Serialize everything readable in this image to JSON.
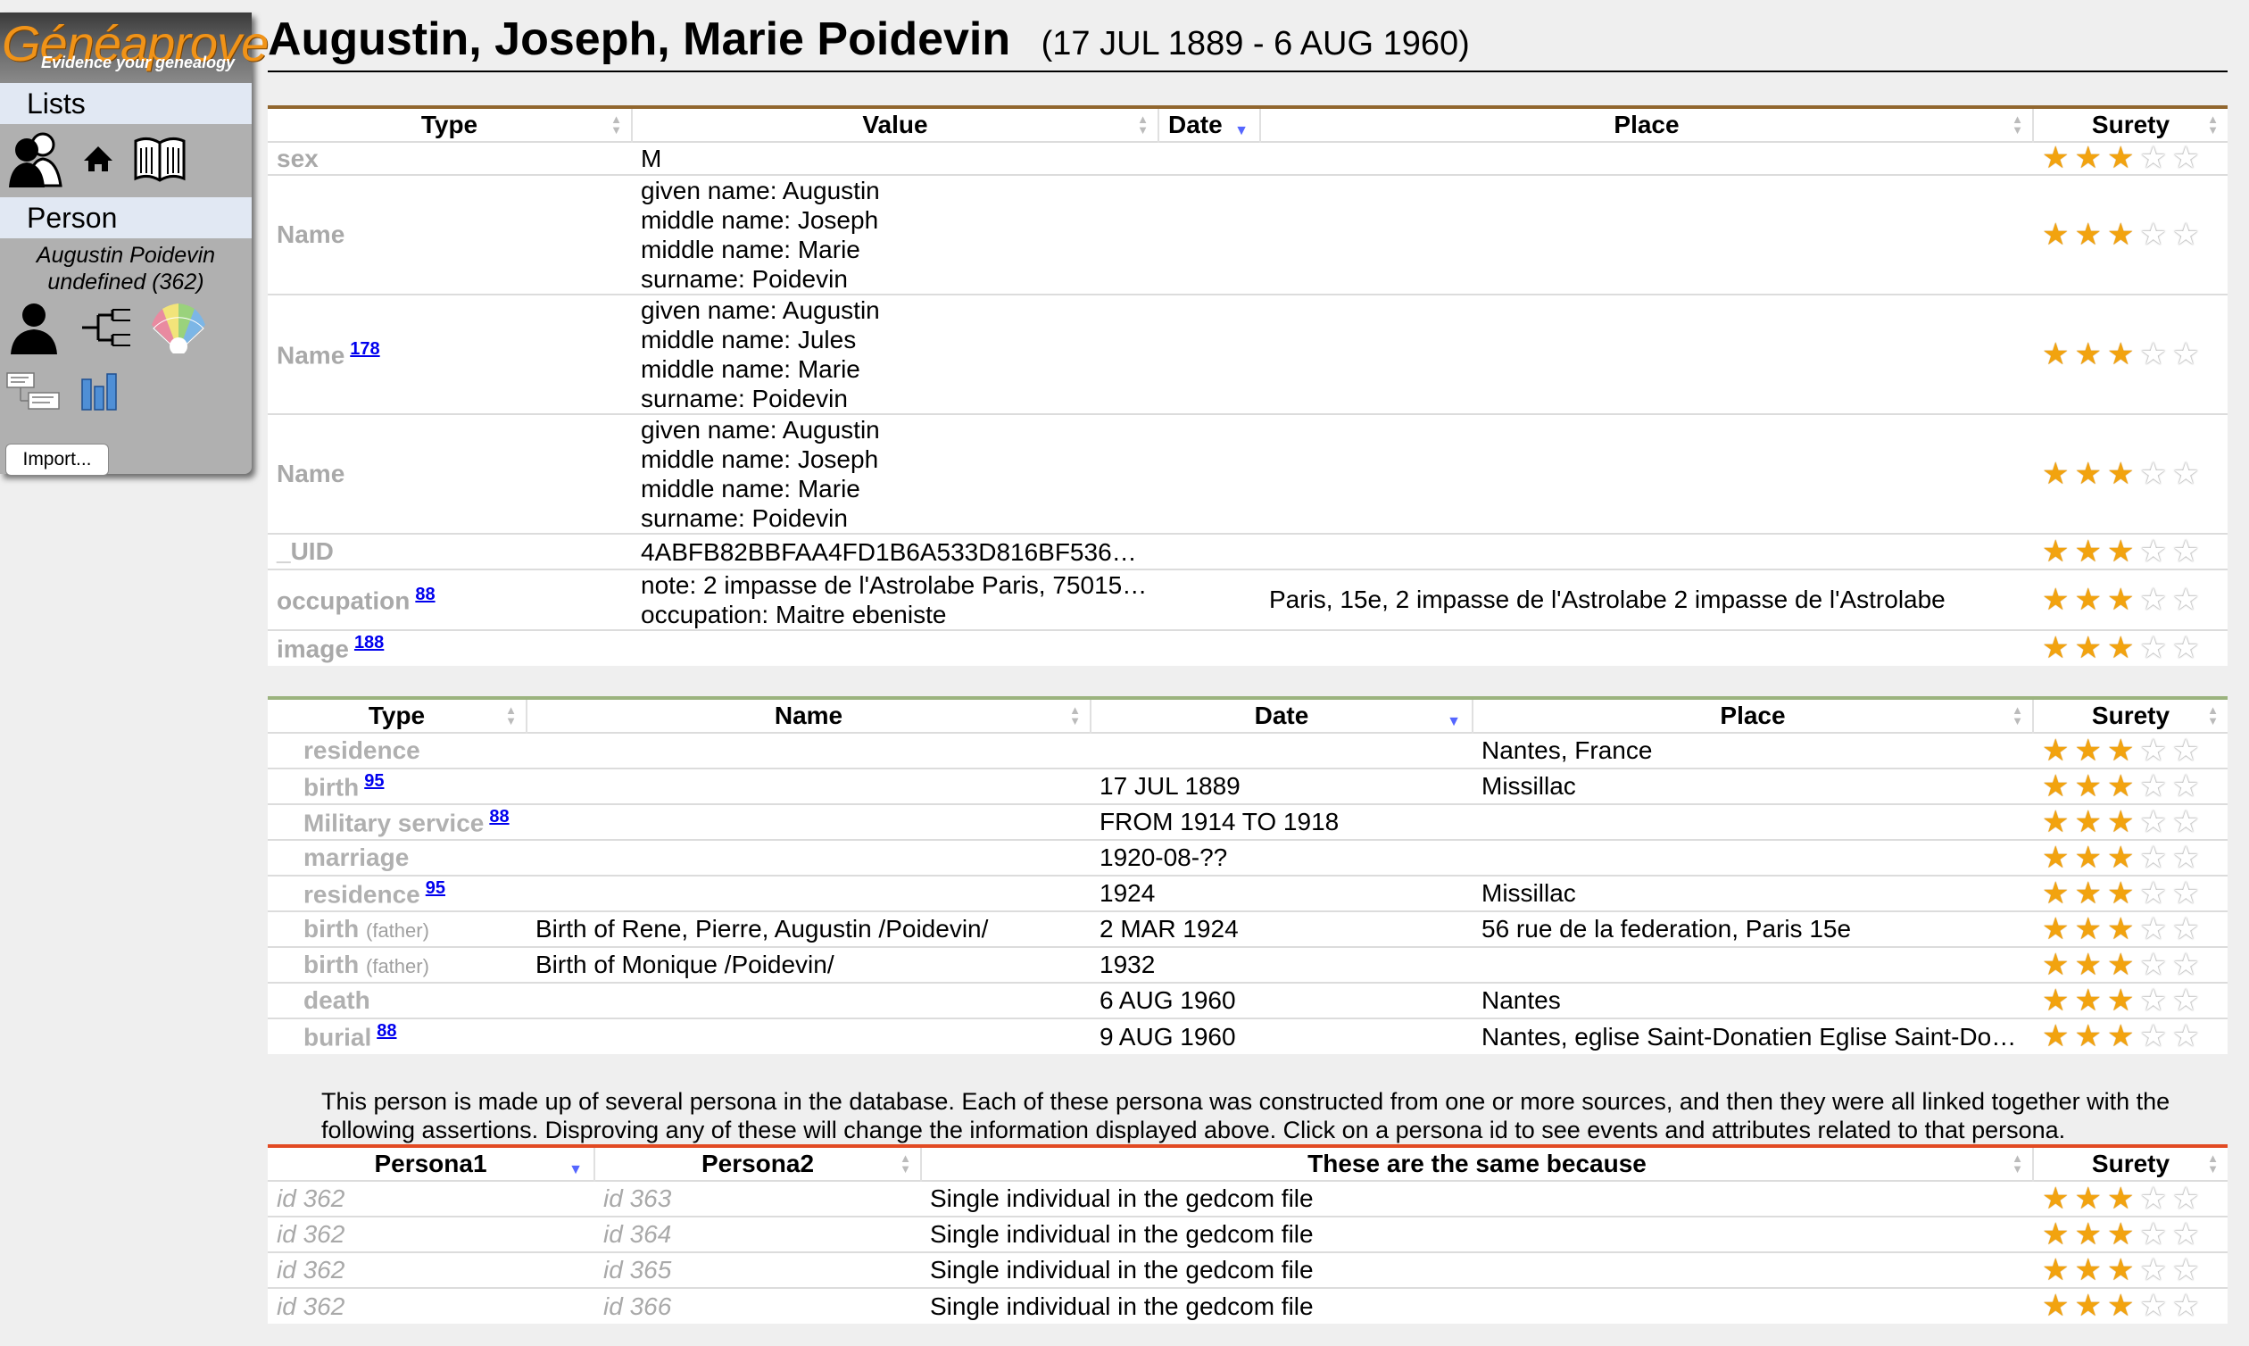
{
  "app": {
    "brand": "Généaprove",
    "tagline": "Evidence your genealogy",
    "lists_label": "Lists",
    "person_label": "Person",
    "person_name": "Augustin Poidevin",
    "person_sub": "undefined (362)",
    "import_label": "Import..."
  },
  "header": {
    "name": "Augustin, Joseph, Marie Poidevin",
    "dates": "(17 JUL 1889 - 6 AUG 1960)"
  },
  "colors": {
    "attributes_rule": "#91662e",
    "events_rule": "#9bb37e",
    "assertions_rule": "#e24a23",
    "star_on": "#f2a30f",
    "link": "#0000ee"
  },
  "attributes": {
    "columns": [
      "Type",
      "Value",
      "Date",
      "Place",
      "Surety"
    ],
    "rows": [
      {
        "type": "sex",
        "ref": "",
        "value": [
          "M"
        ],
        "date": "",
        "place": "",
        "surety": 3
      },
      {
        "type": "Name",
        "ref": "",
        "value": [
          "given name: Augustin",
          "middle name: Joseph",
          "middle name: Marie",
          "surname: Poidevin"
        ],
        "date": "",
        "place": "",
        "surety": 3
      },
      {
        "type": "Name",
        "ref": "178",
        "value": [
          "given name: Augustin",
          "middle name: Jules",
          "middle name: Marie",
          "surname: Poidevin"
        ],
        "date": "",
        "place": "",
        "surety": 3
      },
      {
        "type": "Name",
        "ref": "",
        "value": [
          "given name: Augustin",
          "middle name: Joseph",
          "middle name: Marie",
          "surname: Poidevin"
        ],
        "date": "",
        "place": "",
        "surety": 3
      },
      {
        "type": "_UID",
        "ref": "",
        "value": [
          "4ABFB82BBFAA4FD1B6A533D816BF536…"
        ],
        "date": "",
        "place": "",
        "surety": 3
      },
      {
        "type": "occupation",
        "ref": "88",
        "value": [
          "note: 2 impasse de l'Astrolabe Paris, 75015…",
          "occupation: Maitre ebeniste"
        ],
        "date": "",
        "place": "Paris, 15e, 2 impasse de l'Astrolabe 2 impasse de l'Astrolabe",
        "surety": 3
      },
      {
        "type": "image",
        "ref": "188",
        "value": [],
        "date": "",
        "place": "",
        "surety": 3
      }
    ]
  },
  "events": {
    "columns": [
      "Type",
      "Name",
      "Date",
      "Place",
      "Surety"
    ],
    "rows": [
      {
        "type": "residence",
        "ref": "",
        "role": "",
        "name": "",
        "date": "",
        "place": "Nantes, France",
        "surety": 3
      },
      {
        "type": "birth",
        "ref": "95",
        "role": "",
        "name": "",
        "date": "17 JUL 1889",
        "place": "Missillac",
        "surety": 3
      },
      {
        "type": "Military service",
        "ref": "88",
        "role": "",
        "name": "",
        "date": "FROM 1914 TO 1918",
        "place": "",
        "surety": 3
      },
      {
        "type": "marriage",
        "ref": "",
        "role": "",
        "name": "",
        "date": "1920-08-??",
        "place": "",
        "surety": 3
      },
      {
        "type": "residence",
        "ref": "95",
        "role": "",
        "name": "",
        "date": "1924",
        "place": "Missillac",
        "surety": 3
      },
      {
        "type": "birth",
        "ref": "",
        "role": "(father)",
        "name": "Birth of Rene, Pierre, Augustin /Poidevin/",
        "date": "2 MAR 1924",
        "place": "56 rue de la federation, Paris 15e",
        "surety": 3
      },
      {
        "type": "birth",
        "ref": "",
        "role": "(father)",
        "name": "Birth of Monique /Poidevin/",
        "date": "1932",
        "place": "",
        "surety": 3
      },
      {
        "type": "death",
        "ref": "",
        "role": "",
        "name": "",
        "date": "6 AUG 1960",
        "place": "Nantes",
        "surety": 3
      },
      {
        "type": "burial",
        "ref": "88",
        "role": "",
        "name": "",
        "date": "9 AUG 1960",
        "place": "Nantes, eglise Saint-Donatien Eglise Saint-Do…",
        "surety": 3
      }
    ]
  },
  "note": "This person is made up of several persona in the database. Each of these persona was constructed from one or more sources, and then they were all linked together with the following assertions. Disproving any of these will change the information displayed above. Click on a persona id to see events and attributes related to that persona.",
  "assertions": {
    "columns": [
      "Persona1",
      "Persona2",
      "These are the same because",
      "Surety"
    ],
    "rows": [
      {
        "p1": "id 362",
        "p2": "id 363",
        "reason": "Single individual in the gedcom file",
        "surety": 3
      },
      {
        "p1": "id 362",
        "p2": "id 364",
        "reason": "Single individual in the gedcom file",
        "surety": 3
      },
      {
        "p1": "id 362",
        "p2": "id 365",
        "reason": "Single individual in the gedcom file",
        "surety": 3
      },
      {
        "p1": "id 362",
        "p2": "id 366",
        "reason": "Single individual in the gedcom file",
        "surety": 3
      }
    ]
  }
}
